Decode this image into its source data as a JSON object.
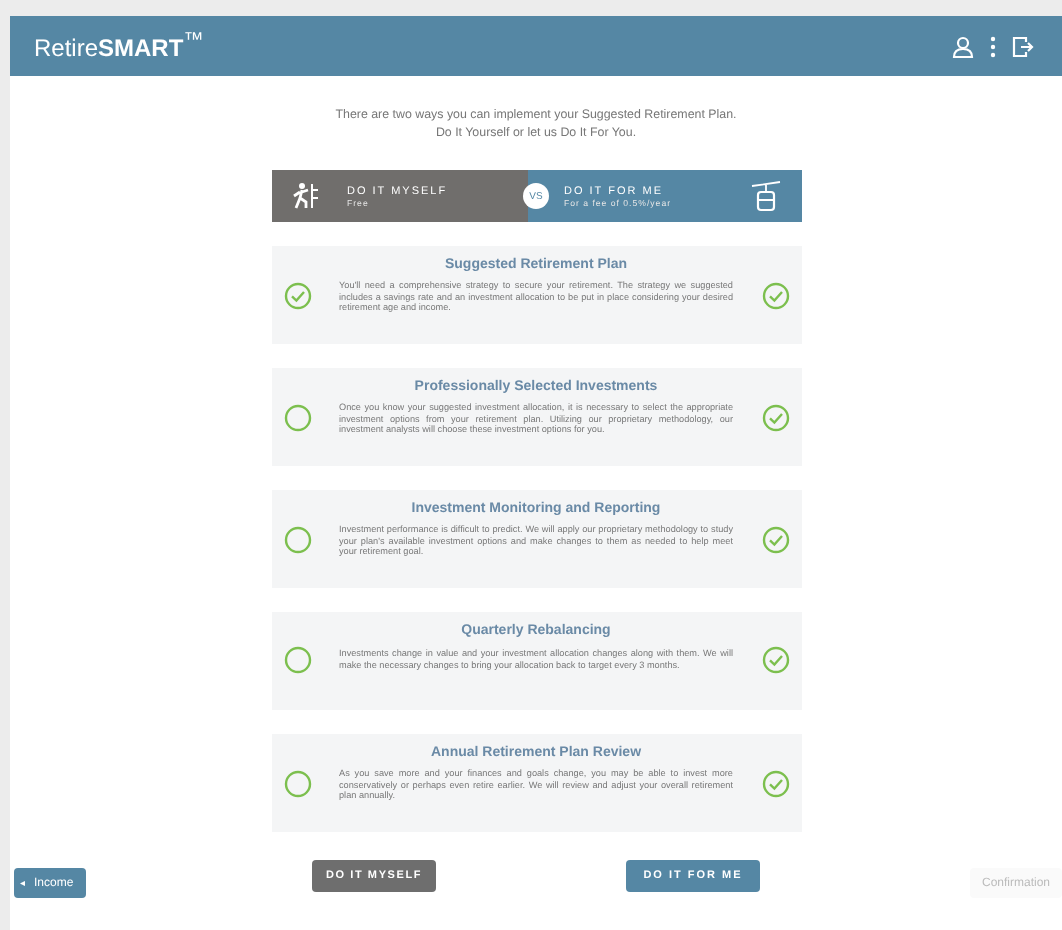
{
  "header": {
    "logo": "Retire**SMART**$^{™}$"
  },
  "intro": [
    "There are two ways you can implement your Suggested Retirement Plan.",
    "Do It Yourself or let us Do It For You."
  ],
  "compare": {
    "left": {
      "title": "DO IT MYSELF",
      "subtitle": "Free"
    },
    "vs": "VS",
    "right": {
      "title": "DO IT FOR ME",
      "subtitle": "For a fee of 0.5%/year"
    }
  },
  "features": [
    {
      "title": "Suggested Retirement Plan",
      "text": "You'll need a comprehensive strategy to secure your retirement. The strategy we suggested includes a savings rate and an investment allocation to be put in place considering your desired retirement age and income.",
      "myself": true,
      "for_me": true
    },
    {
      "title": "Professionally Selected Investments",
      "text": "Once you know your suggested investment allocation, it is necessary to select the appropriate investment options from your retirement plan. Utilizing our proprietary methodology, our investment analysts will choose these investment options for you.",
      "myself": false,
      "for_me": true
    },
    {
      "title": "Investment Monitoring and Reporting",
      "text": "Investment performance is difficult to predict. We will apply our proprietary methodology to study your plan's available investment options and make changes to them as needed to help meet your retirement goal.",
      "myself": false,
      "for_me": true
    },
    {
      "title": "Quarterly Rebalancing",
      "text": "Investments change in value and your investment allocation changes along with them. We will make the necessary changes to bring your allocation back to target every 3 months.",
      "myself": false,
      "for_me": true
    },
    {
      "title": "Annual Retirement Plan Review",
      "text": "As you save more and your finances and goals change, you may be able to invest more conservatively or perhaps even retire earlier. We will review and adjust your overall retirement plan annually.",
      "myself": false,
      "for_me": true
    }
  ],
  "buttons": {
    "myself": "DO IT MYSELF",
    "for_me": "DO IT FOR ME"
  },
  "nav": {
    "back": {
      "icon": "◂",
      "label": "Income"
    },
    "next": {
      "label": "Confirmation",
      "disabled": true
    }
  }
}
